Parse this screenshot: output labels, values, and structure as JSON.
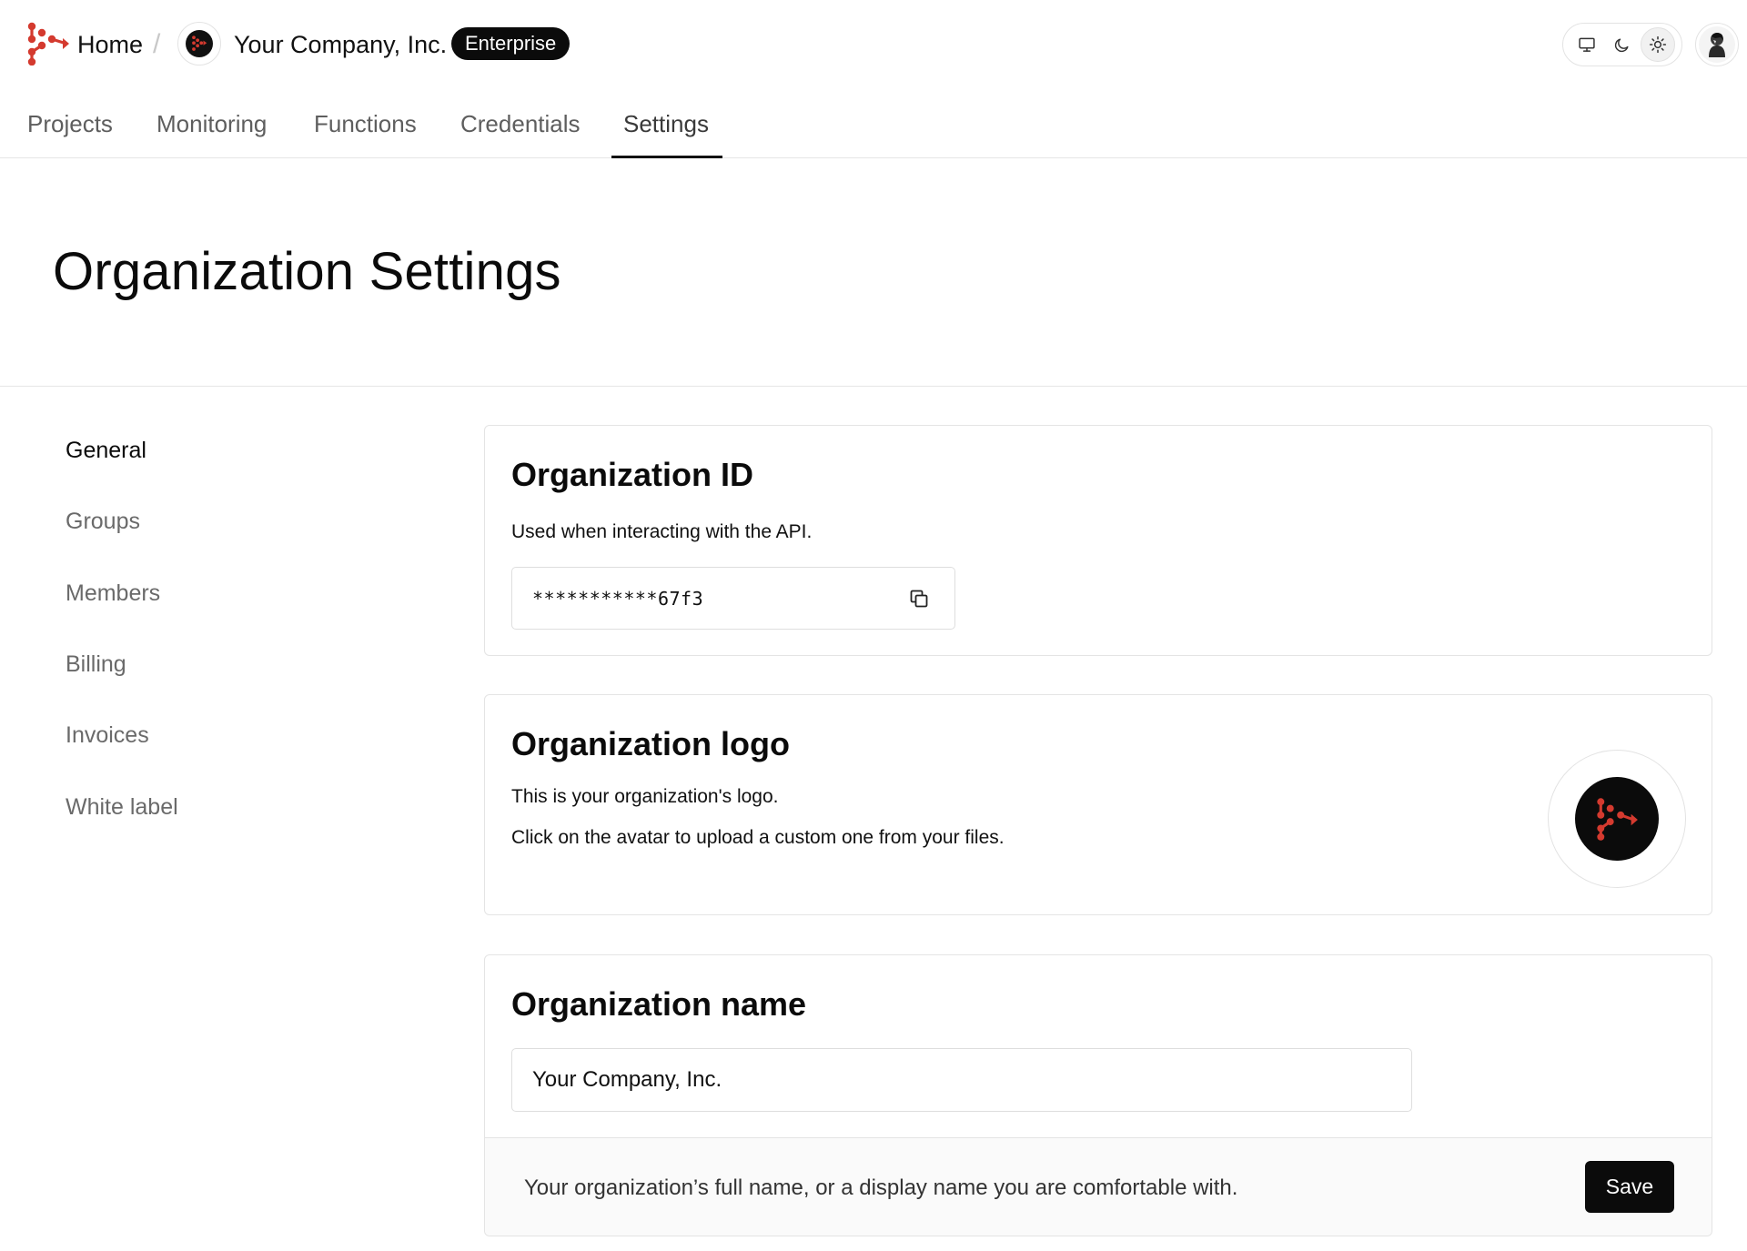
{
  "colors": {
    "accent": "#d43a2f",
    "dark": "#0b0b0b",
    "muted_text": "#6a6a6a",
    "border": "#e4e4e4"
  },
  "header": {
    "brand_icon": "brand-logo-icon",
    "home_label": "Home",
    "separator": "/",
    "org_avatar_icon": "org-logo-icon",
    "org_name": "Your Company, Inc.",
    "plan_badge": "Enterprise",
    "theme_options": [
      {
        "name": "system",
        "icon": "monitor-icon"
      },
      {
        "name": "dark",
        "icon": "moon-icon"
      },
      {
        "name": "light",
        "icon": "sun-icon",
        "selected": true
      }
    ],
    "user_avatar_icon": "user-avatar-icon"
  },
  "tabs": [
    {
      "label": "Projects"
    },
    {
      "label": "Monitoring"
    },
    {
      "label": "Functions"
    },
    {
      "label": "Credentials"
    },
    {
      "label": "Settings",
      "active": true
    }
  ],
  "page": {
    "title": "Organization Settings"
  },
  "sidemenu": [
    {
      "label": "General",
      "active": true
    },
    {
      "label": "Groups"
    },
    {
      "label": "Members"
    },
    {
      "label": "Billing"
    },
    {
      "label": "Invoices"
    },
    {
      "label": "White label"
    }
  ],
  "org_id_card": {
    "title": "Organization ID",
    "description": "Used when interacting with the API.",
    "value": "***********67f3",
    "copy_icon": "copy-icon"
  },
  "logo_card": {
    "title": "Organization logo",
    "line1": "This is your organization's logo.",
    "line2": "Click on the avatar to upload a custom one from your files.",
    "logo_icon": "org-logo-icon"
  },
  "name_card": {
    "title": "Organization name",
    "input_value": "Your Company, Inc.",
    "hint": "Your organization’s full name, or a display name you are comfortable with.",
    "save_label": "Save"
  }
}
